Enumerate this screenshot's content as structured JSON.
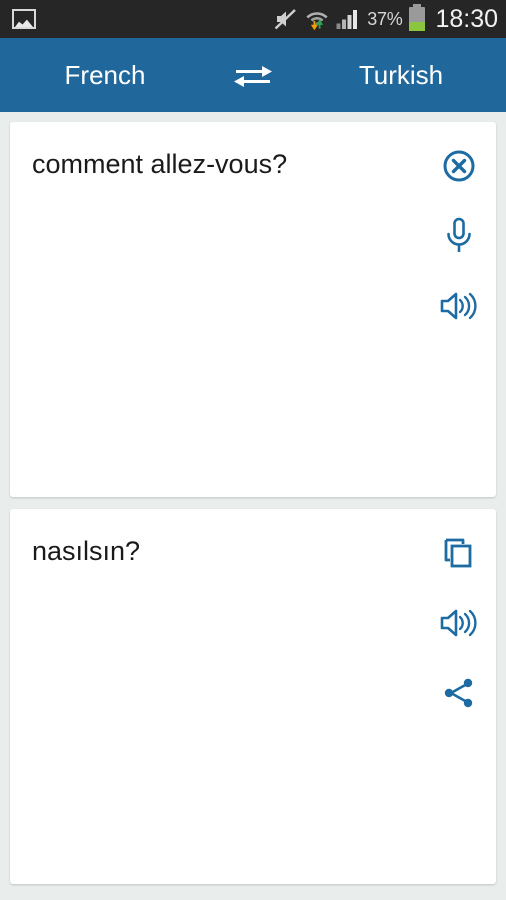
{
  "status_bar": {
    "notification_icon": "photo-icon",
    "mute_icon": "volume-mute-icon",
    "wifi_icon": "wifi-transfer-icon",
    "signal_icon": "cellular-signal-icon",
    "battery_percent": "37%",
    "battery_level": 37,
    "battery_icon": "battery-icon",
    "time": "18:30"
  },
  "language_bar": {
    "source_language": "French",
    "target_language": "Turkish",
    "swap_icon": "swap-arrows-icon"
  },
  "source_card": {
    "text": "comment allez-vous?",
    "placeholder": "",
    "actions": [
      {
        "name": "clear-button",
        "icon": "close-circle-icon"
      },
      {
        "name": "voice-input-button",
        "icon": "microphone-icon"
      },
      {
        "name": "speak-source-button",
        "icon": "speaker-icon"
      }
    ]
  },
  "target_card": {
    "text": "nasılsın?",
    "actions": [
      {
        "name": "copy-button",
        "icon": "copy-icon"
      },
      {
        "name": "speak-target-button",
        "icon": "speaker-icon"
      },
      {
        "name": "share-button",
        "icon": "share-icon"
      }
    ]
  },
  "colors": {
    "accent": "#20679c",
    "icon": "#1d6ba3",
    "status_bar_bg": "#262626",
    "page_bg": "#e9eeed",
    "card_bg": "#ffffff",
    "battery_fill": "#8cc63e"
  }
}
